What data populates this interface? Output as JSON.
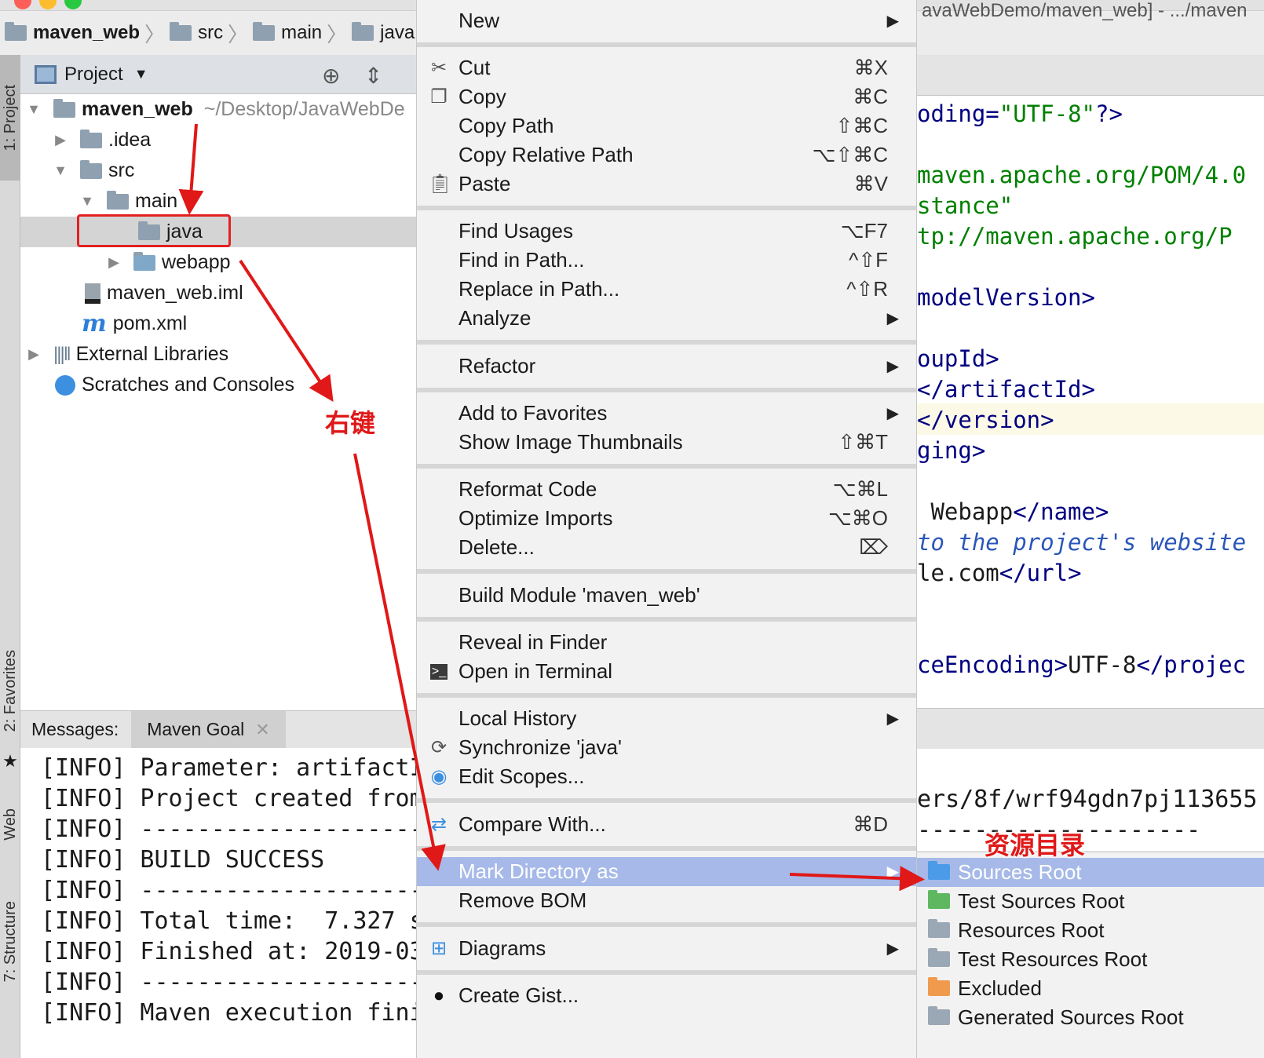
{
  "window": {
    "path_fragment": "avaWebDemo/maven_web] - .../maven"
  },
  "breadcrumb": [
    {
      "label": "maven_web",
      "bold": true
    },
    {
      "label": "src",
      "bold": false
    },
    {
      "label": "main",
      "bold": false
    },
    {
      "label": "java",
      "bold": false
    }
  ],
  "tool_strip": {
    "project": "1: Project",
    "favorites": "2: Favorites",
    "web": "Web",
    "structure": "7: Structure"
  },
  "project_panel": {
    "title": "Project",
    "tree": [
      {
        "label": "maven_web",
        "hint": "~/Desktop/JavaWebDe",
        "bold": true,
        "level": 0,
        "arrow": "down",
        "icon": "module-folder-icon"
      },
      {
        "label": ".idea",
        "level": 1,
        "arrow": "right",
        "icon": "folder-icon"
      },
      {
        "label": "src",
        "level": 1,
        "arrow": "down",
        "icon": "folder-icon"
      },
      {
        "label": "main",
        "level": 2,
        "arrow": "down",
        "icon": "folder-icon"
      },
      {
        "label": "java",
        "level": 3,
        "arrow": "",
        "icon": "folder-icon",
        "selected": true
      },
      {
        "label": "webapp",
        "level": 3,
        "arrow": "right",
        "icon": "web-folder-icon"
      },
      {
        "label": "maven_web.iml",
        "level": 2,
        "arrow": "",
        "icon": "iml-file-icon"
      },
      {
        "label": "pom.xml",
        "level": 2,
        "arrow": "",
        "icon": "maven-icon"
      },
      {
        "label": "External Libraries",
        "level": 0,
        "arrow": "right",
        "icon": "library-icon"
      },
      {
        "label": "Scratches and Consoles",
        "level": 0,
        "arrow": "",
        "icon": "scratch-icon"
      }
    ]
  },
  "messages": {
    "label": "Messages:",
    "tab": "Maven Goal",
    "lines": [
      "[INFO] Parameter: artifactI",
      "[INFO] Project created from",
      "[INFO] --------------------",
      "[INFO] BUILD SUCCESS",
      "[INFO] --------------------",
      "[INFO] Total time:  7.327 s",
      "[INFO] Finished at: 2019-03",
      "[INFO] --------------------",
      "[INFO] Maven execution fini"
    ]
  },
  "editor": {
    "lines": [
      {
        "parts": [
          {
            "t": "oding=",
            "c": "tag"
          },
          {
            "t": "\"UTF-8\"",
            "c": "str"
          },
          {
            "t": "?>",
            "c": "tag"
          }
        ]
      },
      {
        "parts": [
          {
            "t": "maven.apache.org/POM/4.0",
            "c": "str"
          }
        ]
      },
      {
        "parts": [
          {
            "t": "stance\"",
            "c": "str"
          }
        ]
      },
      {
        "parts": [
          {
            "t": "tp://maven.apache.org/P",
            "c": "str"
          }
        ]
      },
      {
        "parts": [
          {
            "t": "modelVersion>",
            "c": "tag"
          }
        ]
      },
      {
        "parts": [
          {
            "t": "oupId>",
            "c": "tag"
          }
        ]
      },
      {
        "parts": [
          {
            "t": "</artifactId>",
            "c": "tag"
          }
        ]
      },
      {
        "parts": [
          {
            "t": "</version>",
            "c": "tag"
          }
        ]
      },
      {
        "parts": [
          {
            "t": "ging>",
            "c": "tag"
          }
        ]
      },
      {
        "parts": [
          {
            "t": " Webapp",
            "c": ""
          },
          {
            "t": "</name>",
            "c": "tag"
          }
        ]
      },
      {
        "parts": [
          {
            "t": "to the project's website",
            "c": "ital"
          }
        ]
      },
      {
        "parts": [
          {
            "t": "le.com",
            "c": ""
          },
          {
            "t": "</url>",
            "c": "tag"
          }
        ]
      },
      {
        "parts": [
          {
            "t": "ceEncoding>",
            "c": "tag"
          },
          {
            "t": "UTF-8",
            "c": ""
          },
          {
            "t": "</projec",
            "c": "tag"
          }
        ]
      }
    ],
    "console_lines": [
      "ers/8f/wrf94gdn7pj113655",
      "--------------------"
    ]
  },
  "context_menu": {
    "new": "New",
    "cut": {
      "label": "Cut",
      "shortcut": "⌘X"
    },
    "copy": {
      "label": "Copy",
      "shortcut": "⌘C"
    },
    "copy_path": {
      "label": "Copy Path",
      "shortcut": "⇧⌘C"
    },
    "copy_relative_path": {
      "label": "Copy Relative Path",
      "shortcut": "⌥⇧⌘C"
    },
    "paste": {
      "label": "Paste",
      "shortcut": "⌘V"
    },
    "find_usages": {
      "label": "Find Usages",
      "shortcut": "⌥F7"
    },
    "find_in_path": {
      "label": "Find in Path...",
      "shortcut": "^⇧F"
    },
    "replace_in_path": {
      "label": "Replace in Path...",
      "shortcut": "^⇧R"
    },
    "analyze": "Analyze",
    "refactor": "Refactor",
    "add_to_favorites": "Add to Favorites",
    "show_image_thumbnails": {
      "label": "Show Image Thumbnails",
      "shortcut": "⇧⌘T"
    },
    "reformat_code": {
      "label": "Reformat Code",
      "shortcut": "⌥⌘L"
    },
    "optimize_imports": {
      "label": "Optimize Imports",
      "shortcut": "⌥⌘O"
    },
    "delete": {
      "label": "Delete...",
      "shortcut": "⌦"
    },
    "build_module": "Build Module 'maven_web'",
    "reveal_in_finder": "Reveal in Finder",
    "open_in_terminal": "Open in Terminal",
    "local_history": "Local History",
    "synchronize": "Synchronize 'java'",
    "edit_scopes": "Edit Scopes...",
    "compare_with": {
      "label": "Compare With...",
      "shortcut": "⌘D"
    },
    "mark_directory_as": "Mark Directory as",
    "remove_bom": "Remove BOM",
    "diagrams": "Diagrams",
    "create_gist": "Create Gist..."
  },
  "submenu": [
    {
      "label": "Sources Root",
      "color": "#4c9be8",
      "active": true
    },
    {
      "label": "Test Sources Root",
      "color": "#5fb85f"
    },
    {
      "label": "Resources Root",
      "color": "#9aa7b4"
    },
    {
      "label": "Test Resources Root",
      "color": "#9aa7b4"
    },
    {
      "label": "Excluded",
      "color": "#f09a4e"
    },
    {
      "label": "Generated Sources Root",
      "color": "#9aa7b4"
    }
  ],
  "annotations": {
    "right_click": "右键",
    "source_dir": "资源目录"
  },
  "colors": {
    "highlight": "#a6b9e8",
    "annotation_red": "#e01818",
    "selected_row": "#d4d4d4"
  }
}
